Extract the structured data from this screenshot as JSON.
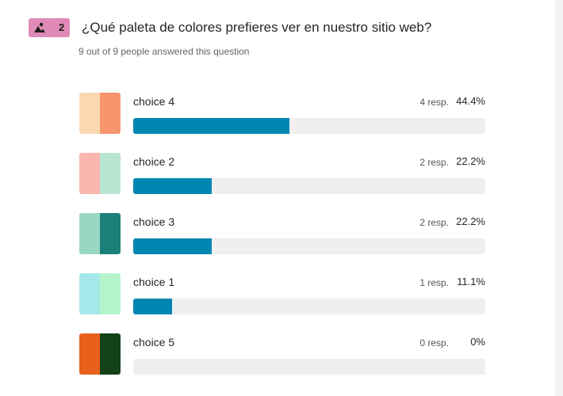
{
  "question": {
    "number": "2",
    "badge_icon": "image-icon",
    "title": "¿Qué paleta de colores prefieres ver en nuestro sitio web?",
    "subtitle": "9 out of 9 people answered this question"
  },
  "colors": {
    "badge": "#e08ab8",
    "bar_fill": "#0087b1",
    "bar_track": "#efefef"
  },
  "options": [
    {
      "label": "choice 4",
      "responses": "4 resp.",
      "percent": "44.4%",
      "fraction": 0.444,
      "swatch": [
        "#fbd7b2",
        "#f7956f"
      ]
    },
    {
      "label": "choice 2",
      "responses": "2 resp.",
      "percent": "22.2%",
      "fraction": 0.222,
      "swatch": [
        "#fab5ad",
        "#b8e5cf"
      ]
    },
    {
      "label": "choice 3",
      "responses": "2 resp.",
      "percent": "22.2%",
      "fraction": 0.222,
      "swatch": [
        "#9ad7c2",
        "#1b8078"
      ]
    },
    {
      "label": "choice 1",
      "responses": "1 resp.",
      "percent": "11.1%",
      "fraction": 0.111,
      "swatch": [
        "#a6e8ea",
        "#b4f5cb"
      ]
    },
    {
      "label": "choice 5",
      "responses": "0 resp.",
      "percent": "0%",
      "fraction": 0.0,
      "swatch": [
        "#e8601b",
        "#12411a"
      ]
    }
  ]
}
